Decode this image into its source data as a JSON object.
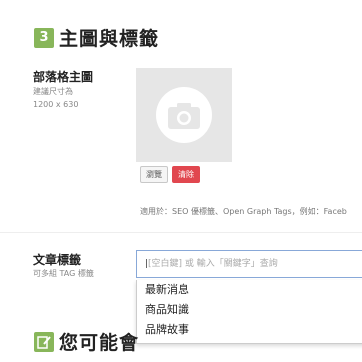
{
  "section": {
    "number": "3",
    "title": "主圖與標籤"
  },
  "image_field": {
    "label": "部落格主圖",
    "hint_line1": "建議尺寸為",
    "hint_line2": "1200 x 630",
    "browse_label": "瀏覽",
    "clear_label": "清除",
    "note": "適用於：SEO 優標籤、Open Graph Tags，例如：Faceb"
  },
  "tag_field": {
    "label": "文章標籤",
    "hint": "可多組 TAG 標籤",
    "placeholder": "[空白鍵] 或 輸入「關鍵字」查詢",
    "options": [
      "最新消息",
      "商品知識",
      "品牌故事"
    ]
  },
  "next_section": {
    "title": "您可能會"
  },
  "colors": {
    "accent_green": "#88b65a",
    "danger": "#e1474f"
  }
}
